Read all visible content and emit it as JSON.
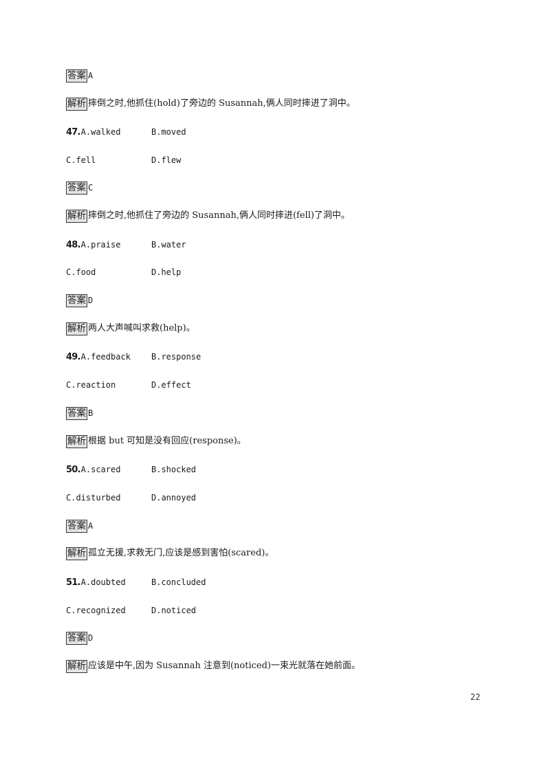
{
  "labels": {
    "answer": "答案",
    "explanation": "解析"
  },
  "blocks": [
    {
      "type": "answer-explanation",
      "answer": "A",
      "explanation": "摔倒之时,他抓住(hold)了旁边的 Susannah,俩人同时摔进了洞中。"
    }
  ],
  "questions": [
    {
      "number": "47.",
      "options": [
        "A.walked",
        "B.moved",
        "C.fell",
        "D.flew"
      ],
      "answer": "C",
      "explanation": "摔倒之时,他抓住了旁边的 Susannah,俩人同时摔进(fell)了洞中。"
    },
    {
      "number": "48.",
      "options": [
        "A.praise",
        "B.water",
        "C.food",
        "D.help"
      ],
      "answer": "D",
      "explanation": "两人大声喊叫求救(help)。"
    },
    {
      "number": "49.",
      "options": [
        "A.feedback",
        "B.response",
        "C.reaction",
        "D.effect"
      ],
      "answer": "B",
      "explanation": "根据 but 可知是没有回应(response)。"
    },
    {
      "number": "50.",
      "options": [
        "A.scared",
        "B.shocked",
        "C.disturbed",
        "D.annoyed"
      ],
      "answer": "A",
      "explanation": "孤立无援,求救无门,应该是感到害怕(scared)。"
    },
    {
      "number": "51.",
      "options": [
        "A.doubted",
        "B.concluded",
        "C.recognized",
        "D.noticed"
      ],
      "answer": "D",
      "explanation": "应该是中午,因为 Susannah 注意到(noticed)一束光就落在她前面。"
    }
  ],
  "page_number": "22"
}
